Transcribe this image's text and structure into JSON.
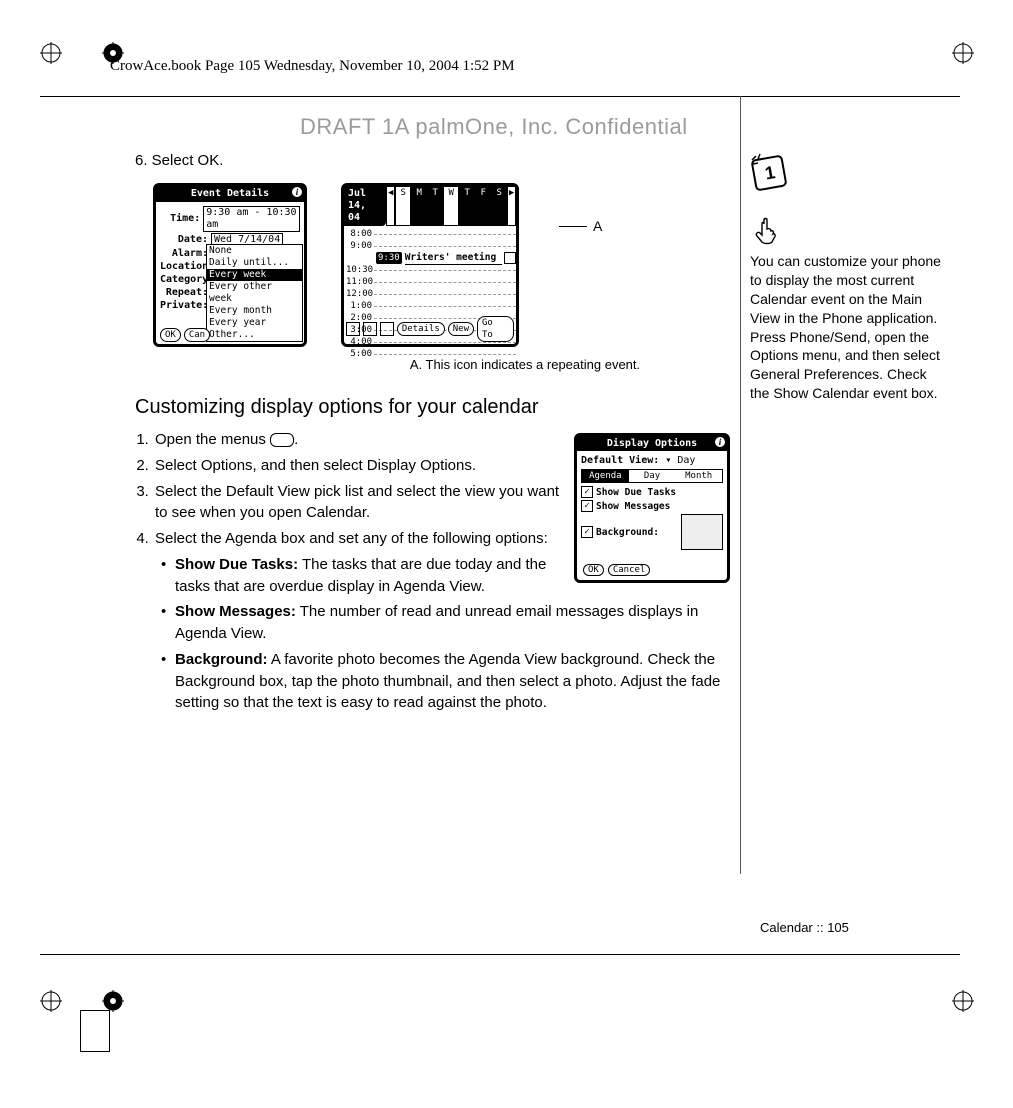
{
  "header": "CrowAce.book  Page 105  Wednesday, November 10, 2004  1:52 PM",
  "watermark": "DRAFT 1A  palmOne, Inc.   Confidential",
  "step6": "6.  Select OK.",
  "eventDetails": {
    "title": "Event Details",
    "rows": {
      "time_lbl": "Time:",
      "time_val": "9:30 am - 10:30 am",
      "date_lbl": "Date:",
      "date_val": "Wed 7/14/04",
      "alarm_lbl": "Alarm:",
      "location_lbl": "Location:",
      "category_lbl": "Category:",
      "repeat_lbl": "Repeat:",
      "private_lbl": "Private:"
    },
    "dropdown": [
      "None",
      "Daily until...",
      "Every week",
      "Every other week",
      "Every month",
      "Every year",
      "Other..."
    ],
    "dropdown_selected_index": 2,
    "ok": "OK",
    "cancel": "Can"
  },
  "dayView": {
    "date": "Jul 14, 04",
    "days": [
      "S",
      "M",
      "T",
      "W",
      "T",
      "F",
      "S"
    ],
    "days_on": [
      0,
      1,
      1,
      0,
      1,
      1,
      1
    ],
    "rows": [
      "8:00",
      "9:00",
      "9:30",
      "10:30",
      "11:00",
      "12:00",
      "1:00",
      "2:00",
      "3:00",
      "4:00",
      "5:00"
    ],
    "event_time": "9:30",
    "event_text": "Writers' meeting",
    "btns": {
      "details": "Details",
      "new": "New",
      "goto": "Go To"
    }
  },
  "callout_A": "A",
  "caption_A": "A. This icon indicates a repeating event.",
  "section_h": "Customizing display options for your calendar",
  "steps": {
    "s1a": "Open the menus ",
    "s1b": ".",
    "s2": "Select Options, and then select Display Options.",
    "s3": "Select the Default View pick list and select the view you want to see when you open Calendar.",
    "s4": "Select the Agenda box and set any of the following options:",
    "b1t": "Show Due Tasks:",
    "b1": " The tasks that are due today and the tasks that are overdue display in Agenda View.",
    "b2t": "Show Messages:",
    "b2": " The number of read and unread email messages displays in Agenda View.",
    "b3t": "Background:",
    "b3": " A favorite photo becomes the Agenda View background. Check the Background box, tap the photo thumbnail, and then select a photo. Adjust the fade setting so that the text is easy to read against the photo."
  },
  "displayOptions": {
    "title": "Display Options",
    "defview_lbl": "Default View:",
    "defview_val": "Day",
    "tabs": [
      "Agenda",
      "Day",
      "Month"
    ],
    "tabs_selected": 0,
    "chk1": "Show Due Tasks",
    "chk2": "Show Messages",
    "chk3": "Background:",
    "ok": "OK",
    "cancel": "Cancel"
  },
  "sidenote": "You can customize your phone to display the most current Calendar event on the Main View in the Phone application. Press Phone/Send, open the Options menu, and then select General Preferences. Check the Show Calendar event box.",
  "footer": "Calendar   ::   105"
}
